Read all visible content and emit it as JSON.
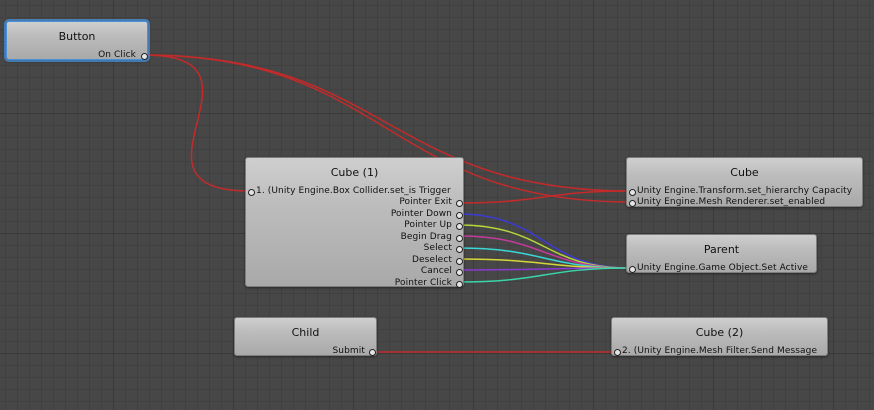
{
  "nodes": {
    "button": {
      "title": "Button",
      "ports": {
        "on_click": "On Click"
      }
    },
    "cube1": {
      "title": "Cube (1)",
      "inputs": [
        "1. (Unity Engine.Box Collider.set_is Trigger"
      ],
      "outputs": [
        "Pointer Exit",
        "Pointer Down",
        "Pointer Up",
        "Begin Drag",
        "Select",
        "Deselect",
        "Cancel",
        "Pointer Click"
      ]
    },
    "cube": {
      "title": "Cube",
      "inputs": [
        "Unity Engine.Transform.set_hierarchy Capacity",
        "Unity Engine.Mesh Renderer.set_enabled"
      ]
    },
    "parent": {
      "title": "Parent",
      "inputs": [
        "Unity Engine.Game Object.Set Active"
      ]
    },
    "child": {
      "title": "Child",
      "outputs": [
        "Submit"
      ]
    },
    "cube2": {
      "title": "Cube (2)",
      "inputs": [
        "2. (Unity Engine.Mesh Filter.Send Message"
      ]
    }
  },
  "colors": {
    "background": "#474747",
    "selection": "#4a90d9",
    "wires": {
      "red": "#c42a2a",
      "blue": "#3b3bd6",
      "yellow_green": "#b5d63a",
      "magenta": "#c43a9c",
      "cyan": "#3ad6d6",
      "yellow": "#d6d63a",
      "purple": "#8a3ad6",
      "teal": "#3ad6a8"
    }
  },
  "icons": {
    "port": "socket-dot-icon"
  }
}
